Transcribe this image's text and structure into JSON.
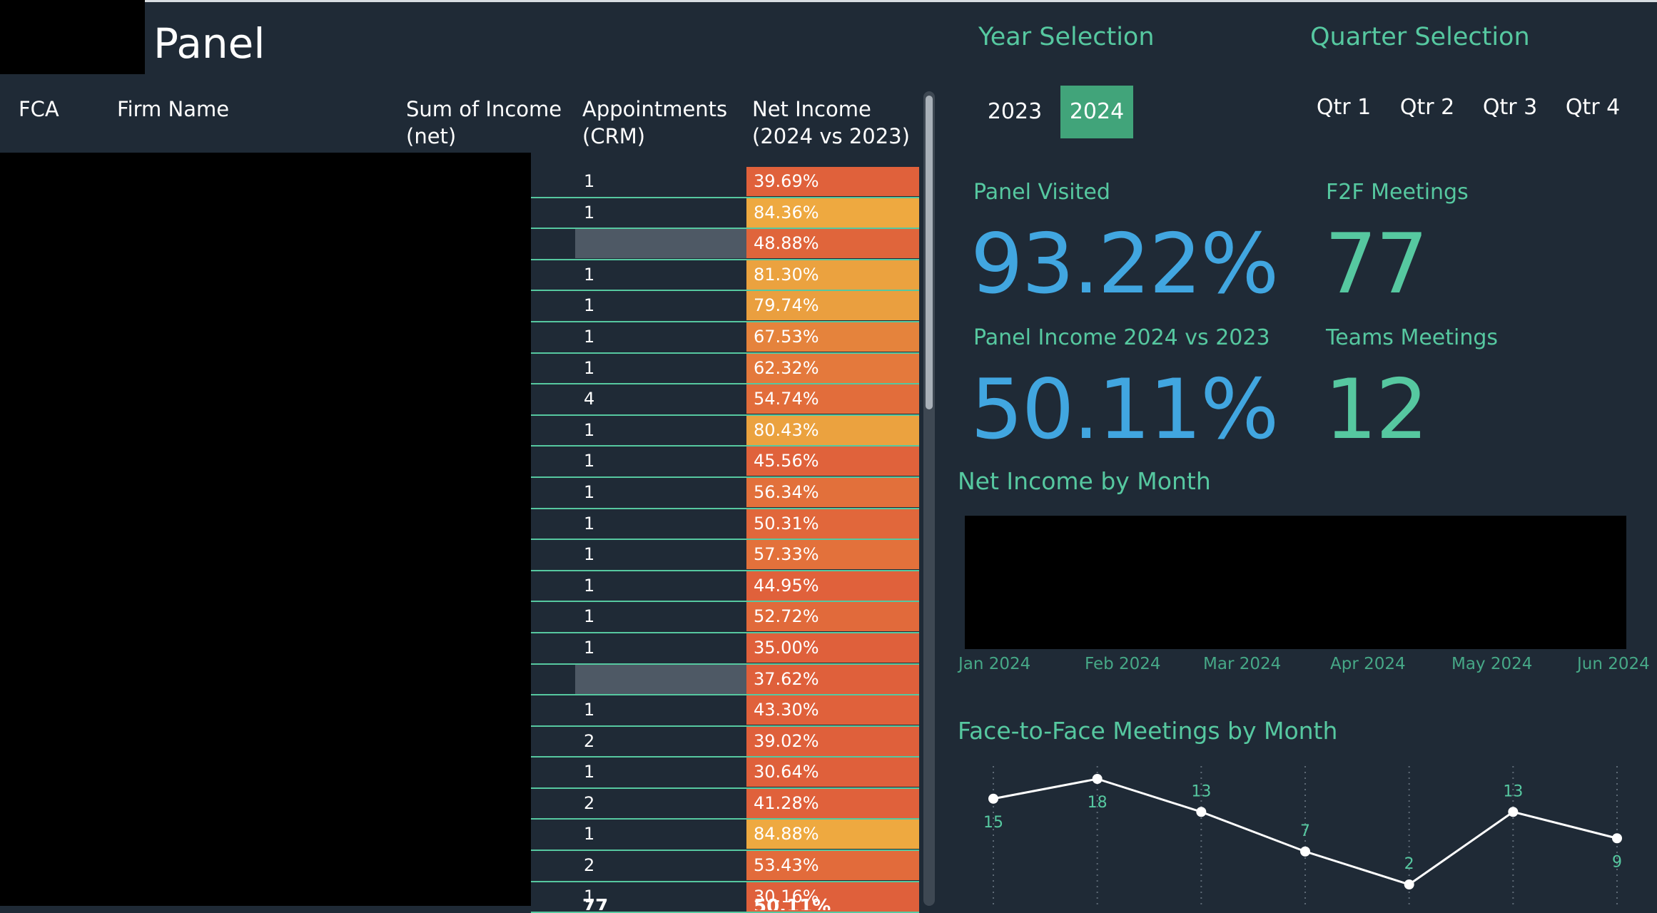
{
  "header": {
    "title": "Panel"
  },
  "table": {
    "columns": [
      "FCA",
      "Firm Name",
      "Sum of Income\n(net)",
      "Appointments\n(CRM)",
      "Net Income\n(2024 vs 2023)"
    ],
    "rows": [
      {
        "appointments": "1",
        "net_income": "39.69%",
        "color": "#e0613b"
      },
      {
        "appointments": "1",
        "net_income": "84.36%",
        "color": "#eea940"
      },
      {
        "appointments": "",
        "net_income": "48.88%",
        "color": "#e0653b"
      },
      {
        "appointments": "1",
        "net_income": "81.30%",
        "color": "#eba23f"
      },
      {
        "appointments": "1",
        "net_income": "79.74%",
        "color": "#ea9f3f"
      },
      {
        "appointments": "1",
        "net_income": "67.53%",
        "color": "#e5833c"
      },
      {
        "appointments": "1",
        "net_income": "62.32%",
        "color": "#e4793c"
      },
      {
        "appointments": "4",
        "net_income": "54.74%",
        "color": "#e26d3b"
      },
      {
        "appointments": "1",
        "net_income": "80.43%",
        "color": "#eba23f"
      },
      {
        "appointments": "1",
        "net_income": "45.56%",
        "color": "#e0623b"
      },
      {
        "appointments": "1",
        "net_income": "56.34%",
        "color": "#e2703b"
      },
      {
        "appointments": "1",
        "net_income": "50.31%",
        "color": "#e1673b"
      },
      {
        "appointments": "1",
        "net_income": "57.33%",
        "color": "#e3713b"
      },
      {
        "appointments": "1",
        "net_income": "44.95%",
        "color": "#e0613b"
      },
      {
        "appointments": "1",
        "net_income": "52.72%",
        "color": "#e16a3b"
      },
      {
        "appointments": "1",
        "net_income": "35.00%",
        "color": "#df603b"
      },
      {
        "appointments": "",
        "net_income": "37.62%",
        "color": "#df603b"
      },
      {
        "appointments": "1",
        "net_income": "43.30%",
        "color": "#e0613b"
      },
      {
        "appointments": "2",
        "net_income": "39.02%",
        "color": "#df603b"
      },
      {
        "appointments": "1",
        "net_income": "30.64%",
        "color": "#df603b"
      },
      {
        "appointments": "2",
        "net_income": "41.28%",
        "color": "#e0613b"
      },
      {
        "appointments": "1",
        "net_income": "84.88%",
        "color": "#eea940"
      },
      {
        "appointments": "2",
        "net_income": "53.43%",
        "color": "#e26b3b"
      },
      {
        "appointments": "1",
        "net_income": "30.16%",
        "color": "#df603b"
      }
    ],
    "totals": {
      "appointments": "77",
      "net_income": "50.11%"
    }
  },
  "year_selection": {
    "label": "Year Selection",
    "options": [
      "2023",
      "2024"
    ],
    "selected": "2024"
  },
  "quarter_selection": {
    "label": "Quarter Selection",
    "options": [
      "Qtr 1",
      "Qtr 2",
      "Qtr 3",
      "Qtr 4"
    ]
  },
  "kpis": {
    "panel_visited": {
      "label": "Panel Visited",
      "value": "93.22%"
    },
    "f2f_meetings": {
      "label": "F2F Meetings",
      "value": "77"
    },
    "panel_income": {
      "label": "Panel Income 2024 vs 2023",
      "value": "50.11%"
    },
    "teams_meetings": {
      "label": "Teams Meetings",
      "value": "12"
    }
  },
  "net_income_chart": {
    "title": "Net Income by Month",
    "months": [
      "Jan 2024",
      "Feb 2024",
      "Mar 2024",
      "Apr 2024",
      "May 2024",
      "Jun 2024"
    ]
  },
  "chart_data": {
    "type": "line",
    "title": "Face-to-Face Meetings by Month",
    "categories": [
      "",
      "",
      "",
      "",
      "",
      "",
      ""
    ],
    "values": [
      15,
      18,
      13,
      7,
      2,
      13,
      9
    ],
    "xlabel": "",
    "ylabel": "",
    "grid": "vertical dotted",
    "line_color": "#ffffff",
    "label_color": "#56c8a0"
  }
}
